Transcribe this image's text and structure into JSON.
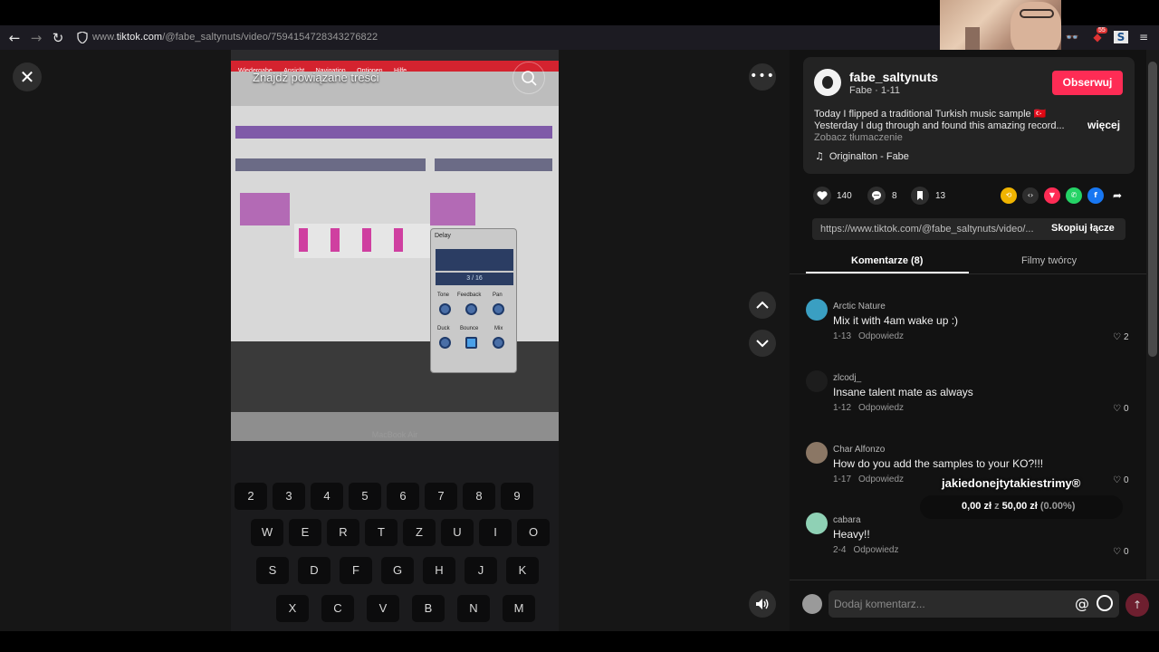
{
  "browser": {
    "url_prefix": "www.",
    "url_host": "tiktok.com",
    "url_path": "/@fabe_saltynuts/video/7594154728343276822",
    "extension_badge": "55"
  },
  "video": {
    "search_overlay": "Znajdź powiązane treści",
    "menu_items": [
      "Wiedergabe",
      "Ansicht",
      "Navigation",
      "Optionen",
      "Hilfe"
    ],
    "delay_title": "Delay",
    "delay_value": "3 / 16",
    "knob_labels": [
      "Tone",
      "Feedback",
      "Pan",
      "Duck",
      "Bounce",
      "Mix"
    ],
    "laptop_label": "MacBook Air",
    "keys_row1": [
      "2",
      "3",
      "4",
      "5",
      "6",
      "7",
      "8",
      "9"
    ],
    "keys_row2": [
      "W",
      "E",
      "R",
      "T",
      "Z",
      "U",
      "I",
      "O"
    ],
    "keys_row3": [
      "S",
      "D",
      "F",
      "G",
      "H",
      "J",
      "K"
    ],
    "keys_row4": [
      "X",
      "C",
      "V",
      "B",
      "N",
      "M"
    ]
  },
  "post": {
    "username": "fabe_saltynuts",
    "meta": "Fabe · 1-11",
    "follow_label": "Obserwuj",
    "desc_line1": "Today I flipped a traditional Turkish music sample 🇹🇷",
    "desc_line2": "Yesterday I dug through and found this amazing record...",
    "more_label": "więcej",
    "translate_label": "Zobacz tłumaczenie",
    "music": "Originalton - Fabe"
  },
  "stats": {
    "likes": "140",
    "comments": "8",
    "saves": "13"
  },
  "share": {
    "link": "https://www.tiktok.com/@fabe_saltynuts/video/...",
    "copy_label": "Skopiuj łącze"
  },
  "tabs": {
    "comments": "Komentarze (8)",
    "creator_videos": "Filmy twórcy"
  },
  "comments": [
    {
      "name": "Arctic Nature",
      "text": "Mix it with 4am wake up :)",
      "date": "1-13",
      "reply": "Odpowiedz",
      "likes": "2"
    },
    {
      "name": "zlcodj_",
      "text": "Insane talent mate as always",
      "date": "1-12",
      "reply": "Odpowiedz",
      "likes": "0"
    },
    {
      "name": "Char Alfonzo",
      "text": "How do you add the samples to your KO?!!!",
      "date": "1-17",
      "reply": "Odpowiedz",
      "likes": "0"
    },
    {
      "name": "cabara",
      "text": "Heavy!!",
      "date": "2-4",
      "reply": "Odpowiedz",
      "likes": "0"
    }
  ],
  "donation_overlay": {
    "title": "jakiedonejtytakiestrimy®",
    "amount": "0,00 zł",
    "separator": "z",
    "goal": "50,00 zł",
    "percent": "(0.00%)"
  },
  "comment_input": {
    "placeholder": "Dodaj komentarz..."
  },
  "colors": {
    "accent": "#fe2c55",
    "background": "#121212"
  }
}
